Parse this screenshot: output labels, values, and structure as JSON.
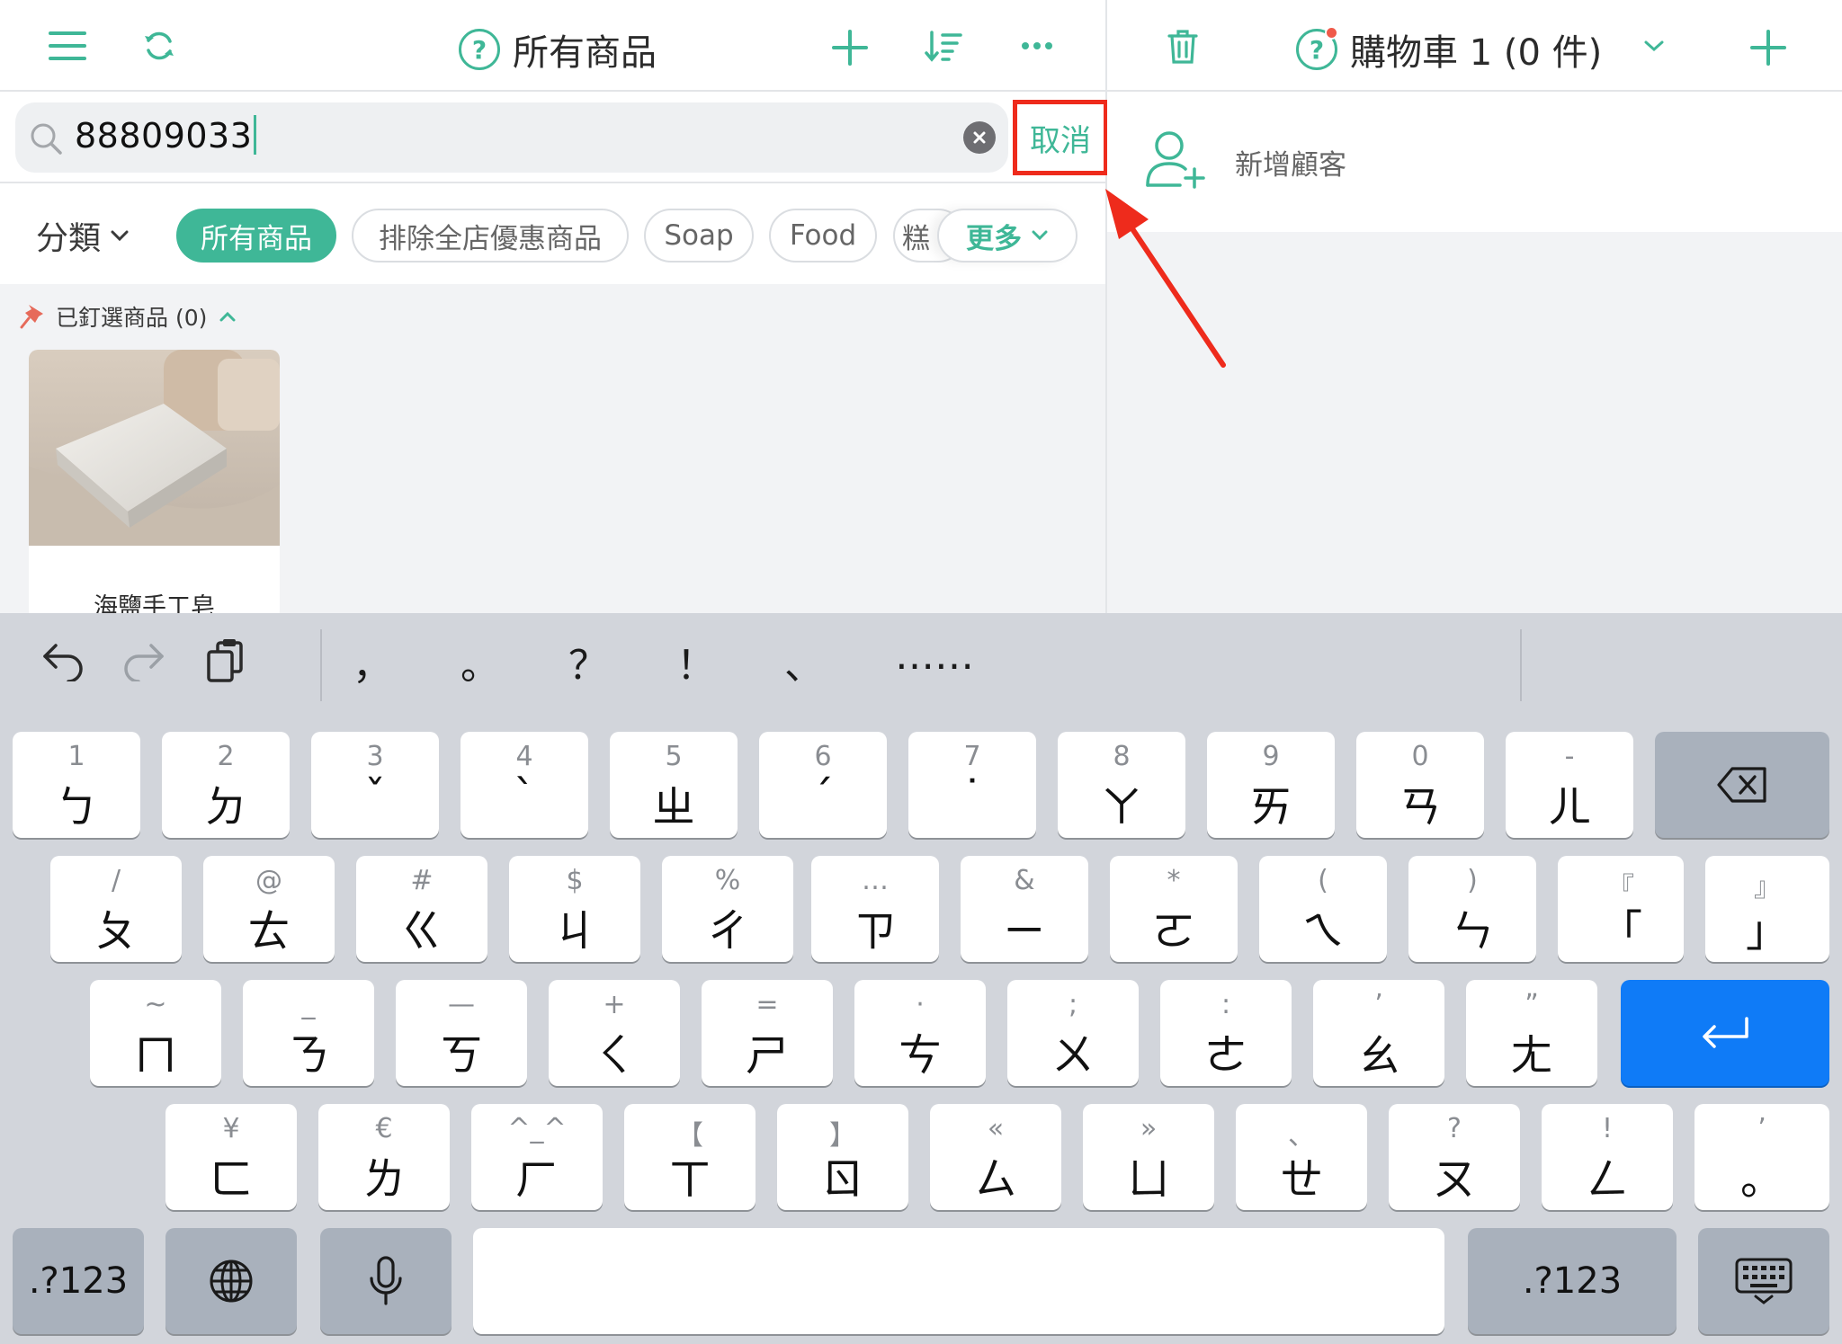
{
  "products_pane": {
    "title": "所有商品",
    "search": {
      "value": "88809033",
      "cancel_label": "取消"
    },
    "filters": {
      "category_label": "分類",
      "chips": [
        "所有商品",
        "排除全店優惠商品",
        "Soap",
        "Food",
        "糕"
      ],
      "more_label": "更多"
    },
    "pinned": {
      "label": "已釘選商品 (0)"
    },
    "products": [
      {
        "name": "海鹽手工皂"
      }
    ]
  },
  "cart_pane": {
    "title": "購物車 1 (0 件)",
    "add_customer_label": "新增顧客"
  },
  "keyboard": {
    "punctuation": [
      "，",
      "。",
      "？",
      "！",
      "、",
      "……"
    ],
    "row1": [
      {
        "sub": "1",
        "main": "ㄅ"
      },
      {
        "sub": "2",
        "main": "ㄉ"
      },
      {
        "sub": "3",
        "main": "ˇ"
      },
      {
        "sub": "4",
        "main": "ˋ"
      },
      {
        "sub": "5",
        "main": "ㄓ"
      },
      {
        "sub": "6",
        "main": "ˊ"
      },
      {
        "sub": "7",
        "main": "˙"
      },
      {
        "sub": "8",
        "main": "ㄚ"
      },
      {
        "sub": "9",
        "main": "ㄞ"
      },
      {
        "sub": "0",
        "main": "ㄢ"
      },
      {
        "sub": "-",
        "main": "ㄦ"
      }
    ],
    "row2": [
      {
        "sub": "/",
        "main": "ㄆ"
      },
      {
        "sub": "@",
        "main": "ㄊ"
      },
      {
        "sub": "#",
        "main": "ㄍ"
      },
      {
        "sub": "$",
        "main": "ㄐ"
      },
      {
        "sub": "%",
        "main": "ㄔ"
      },
      {
        "sub": "…",
        "main": "ㄗ"
      },
      {
        "sub": "&",
        "main": "ㄧ"
      },
      {
        "sub": "*",
        "main": "ㄛ"
      },
      {
        "sub": "(",
        "main": "ㄟ"
      },
      {
        "sub": ")",
        "main": "ㄣ"
      },
      {
        "sub": "『",
        "main": "「"
      },
      {
        "sub": "』",
        "main": "」"
      }
    ],
    "row3": [
      {
        "sub": "~",
        "main": "ㄇ"
      },
      {
        "sub": "_",
        "main": "ㄋ"
      },
      {
        "sub": "—",
        "main": "ㄎ"
      },
      {
        "sub": "+",
        "main": "ㄑ"
      },
      {
        "sub": "=",
        "main": "ㄕ"
      },
      {
        "sub": "·",
        "main": "ㄘ"
      },
      {
        "sub": ";",
        "main": "ㄨ"
      },
      {
        "sub": ":",
        "main": "ㄜ"
      },
      {
        "sub": "’",
        "main": "ㄠ"
      },
      {
        "sub": "”",
        "main": "ㄤ"
      }
    ],
    "row4": [
      {
        "sub": "¥",
        "main": "ㄈ"
      },
      {
        "sub": "€",
        "main": "ㄌ"
      },
      {
        "sub": "^_^",
        "main": "ㄏ"
      },
      {
        "sub": "【",
        "main": "ㄒ"
      },
      {
        "sub": "】",
        "main": "ㄖ"
      },
      {
        "sub": "«",
        "main": "ㄙ"
      },
      {
        "sub": "»",
        "main": "ㄩ"
      },
      {
        "sub": "、",
        "main": "ㄝ"
      },
      {
        "sub": "?",
        "main": "ㄡ"
      },
      {
        "sub": "!",
        "main": "ㄥ"
      },
      {
        "sub": "’",
        "main": "。"
      }
    ],
    "numbers_left": ".?123",
    "numbers_right": ".?123"
  },
  "colors": {
    "accent": "#3fb797",
    "highlight": "#ee2b1c",
    "return_key": "#0f7bf7",
    "keyboard_bg": "#d2d5db"
  }
}
